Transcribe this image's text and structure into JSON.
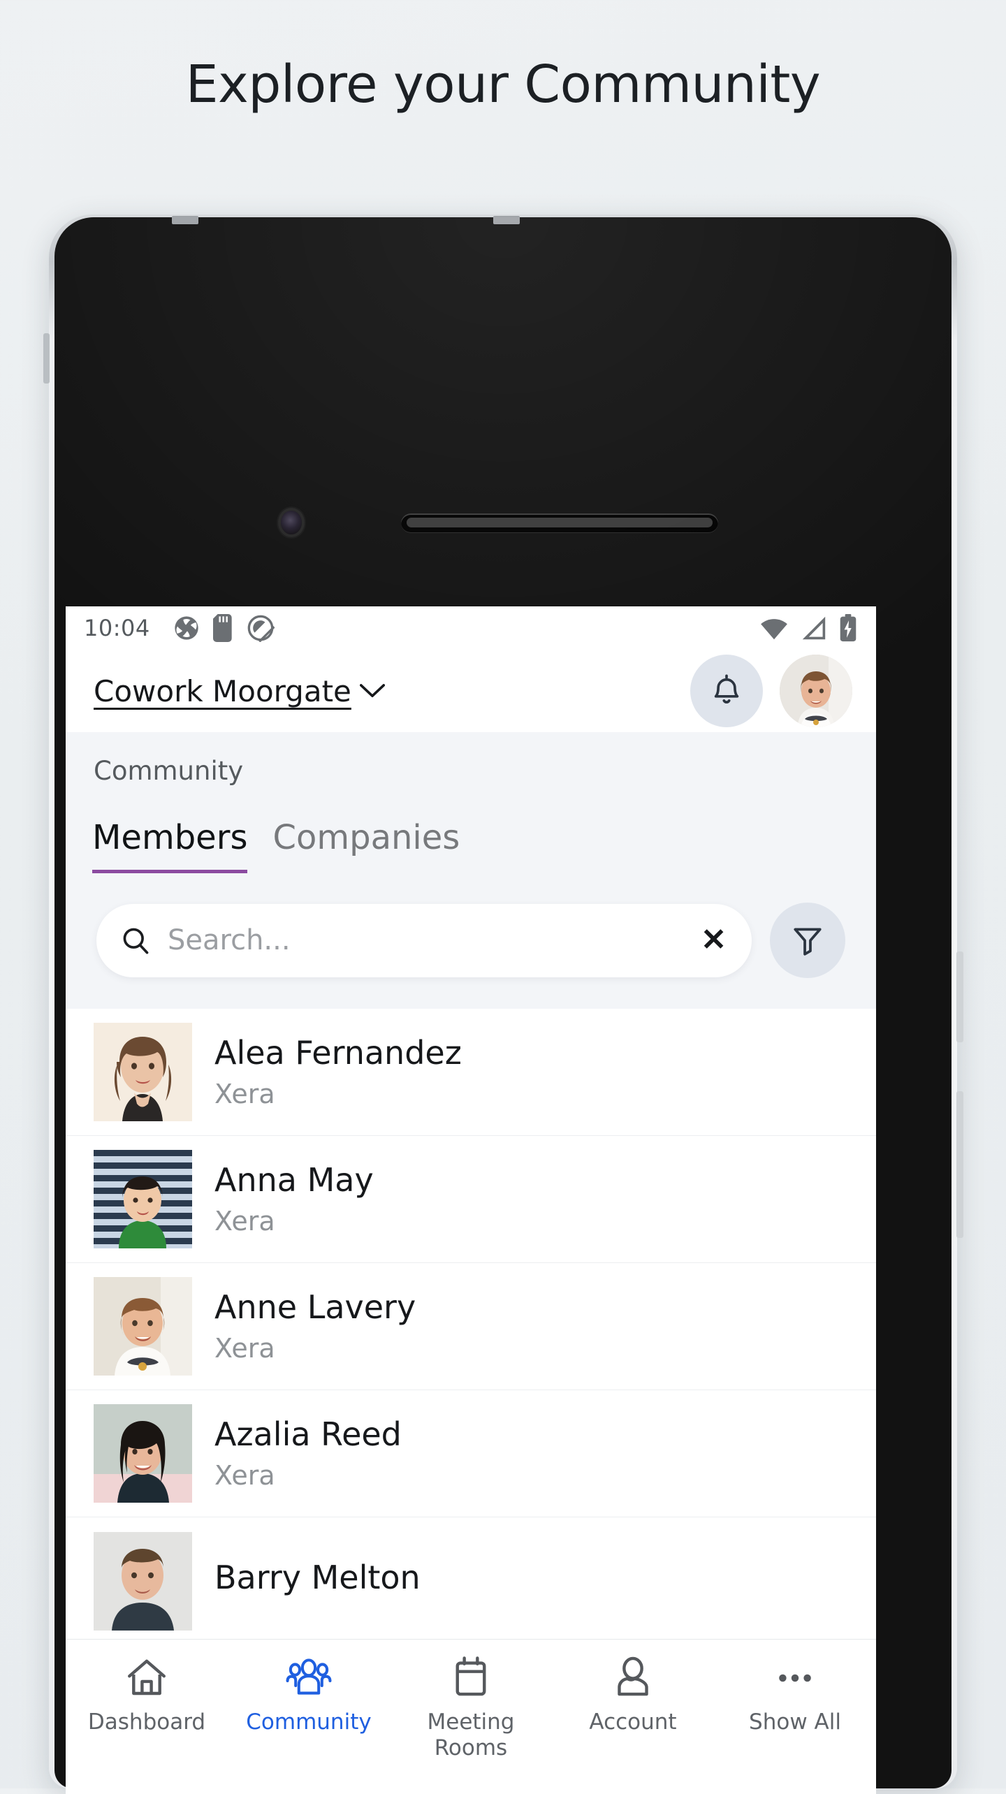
{
  "page": {
    "title": "Explore your Community"
  },
  "statusbar": {
    "time": "10:04",
    "left_icons": [
      "app-shutter-icon",
      "sd-card-icon",
      "do-not-disturb-icon"
    ],
    "right_icons": [
      "wifi-icon",
      "cellular-signal-icon",
      "battery-charging-icon"
    ]
  },
  "header": {
    "venue_name": "Cowork Moorgate",
    "venue_chevron": "chevron-down-icon",
    "notifications_icon": "bell-icon",
    "profile_avatar": "user-avatar"
  },
  "section": {
    "label": "Community",
    "tabs": [
      {
        "label": "Members",
        "active": true
      },
      {
        "label": "Companies",
        "active": false
      }
    ],
    "active_tab_color": "#8b4ba0"
  },
  "search": {
    "placeholder": "Search...",
    "value": "",
    "search_icon": "search-icon",
    "clear_label": "✕",
    "filter_icon": "filter-icon"
  },
  "members": [
    {
      "name": "Alea Fernandez",
      "company": "Xera"
    },
    {
      "name": "Anna May",
      "company": "Xera"
    },
    {
      "name": "Anne Lavery",
      "company": "Xera"
    },
    {
      "name": "Azalia Reed",
      "company": "Xera"
    },
    {
      "name": "Barry Melton",
      "company": ""
    }
  ],
  "bottom_nav": {
    "active_color": "#1f5fe0",
    "items": [
      {
        "label": "Dashboard",
        "icon": "home-icon",
        "active": false
      },
      {
        "label": "Community",
        "icon": "people-icon",
        "active": true
      },
      {
        "label": "Meeting\nRooms",
        "icon": "calendar-icon",
        "active": false
      },
      {
        "label": "Account",
        "icon": "person-icon",
        "active": false
      },
      {
        "label": "Show All",
        "icon": "ellipsis-icon",
        "active": false
      }
    ]
  }
}
